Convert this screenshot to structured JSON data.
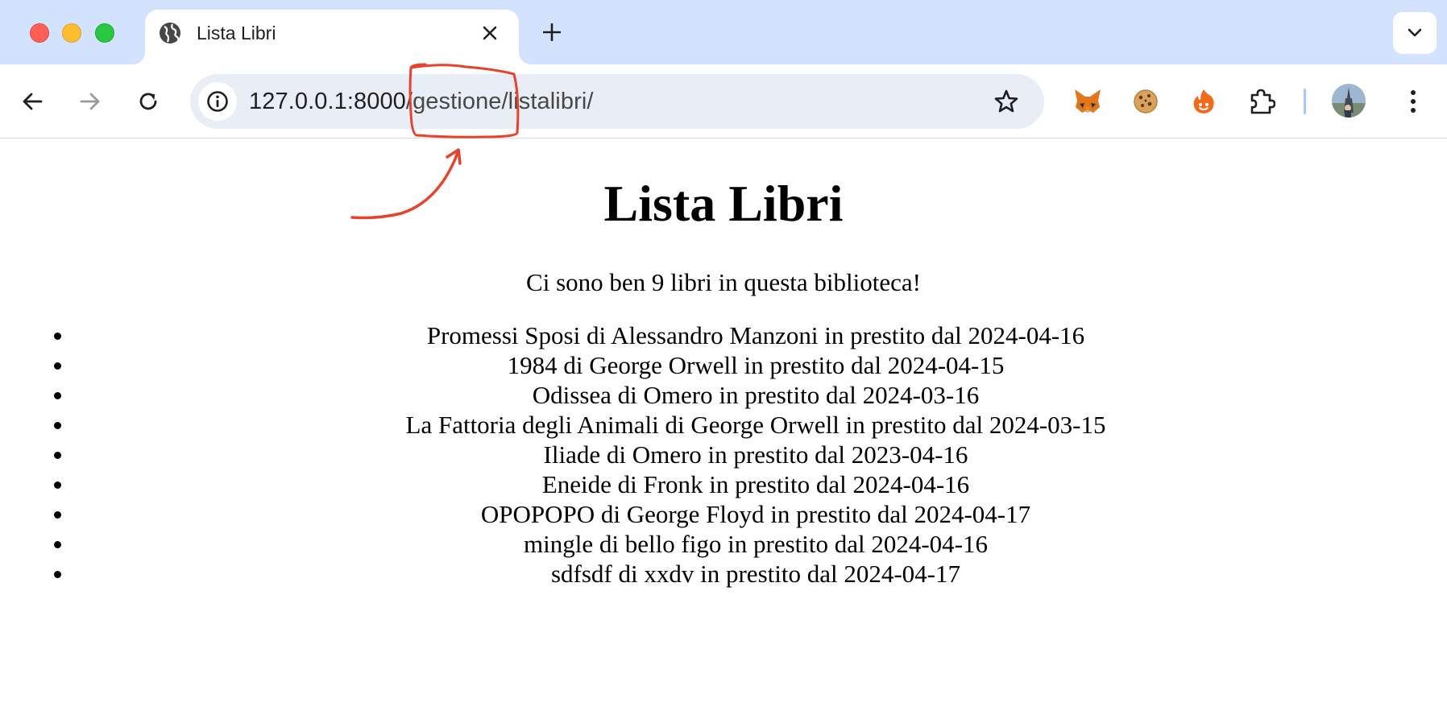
{
  "browser": {
    "tab": {
      "title": "Lista Libri"
    },
    "url": {
      "host": "127.0.0.1:8000",
      "path": "/gestione/listalibri/"
    }
  },
  "page": {
    "heading": "Lista Libri",
    "intro": "Ci sono ben 9 libri in questa biblioteca!",
    "books": [
      "Promessi Sposi di Alessandro Manzoni in prestito dal 2024-04-16",
      "1984 di George Orwell in prestito dal 2024-04-15",
      "Odissea di Omero in prestito dal 2024-03-16",
      "La Fattoria degli Animali di George Orwell in prestito dal 2024-03-15",
      "Iliade di Omero in prestito dal 2023-04-16",
      "Eneide di Fronk in prestito dal 2024-04-16",
      "OPOPOPO di George Floyd in prestito dal 2024-04-17",
      "mingle di bello figo in prestito dal 2024-04-16",
      "sdfsdf di xxdv in prestito dal 2024-04-17"
    ]
  },
  "icons": {
    "tab_favicon": "globe-icon",
    "site_info": "info-icon",
    "extensions": [
      "metamask-fox-icon",
      "cookie-icon",
      "flame-mascot-icon",
      "puzzle-piece-icon"
    ]
  },
  "colors": {
    "tabstrip": "#d3e3fd",
    "omnibox": "#e9eef6",
    "annotation": "#e8412c"
  }
}
